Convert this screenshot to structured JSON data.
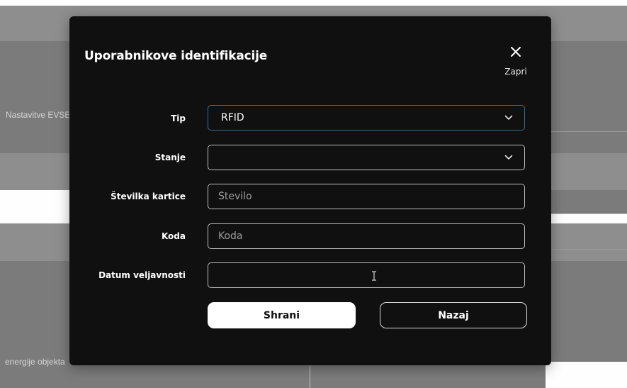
{
  "background": {
    "text_left_1": "Nastavitve EVSE",
    "text_left_2": "energije objekta"
  },
  "modal": {
    "title": "Uporabnikove identifikacije",
    "close_label": "Zapri",
    "fields": {
      "tip": {
        "label": "Tip",
        "value": "RFID"
      },
      "stanje": {
        "label": "Stanje",
        "value": ""
      },
      "card_number": {
        "label": "Številka kartice",
        "placeholder": "Število"
      },
      "code": {
        "label": "Koda",
        "placeholder": "Koda"
      },
      "valid_date": {
        "label": "Datum veljavnosti",
        "value": ""
      }
    },
    "buttons": {
      "save": "Shrani",
      "back": "Nazaj"
    }
  },
  "colors": {
    "modal_bg": "#101010",
    "focus_border": "#3d6e91",
    "overlay": "#7b7b7b"
  }
}
